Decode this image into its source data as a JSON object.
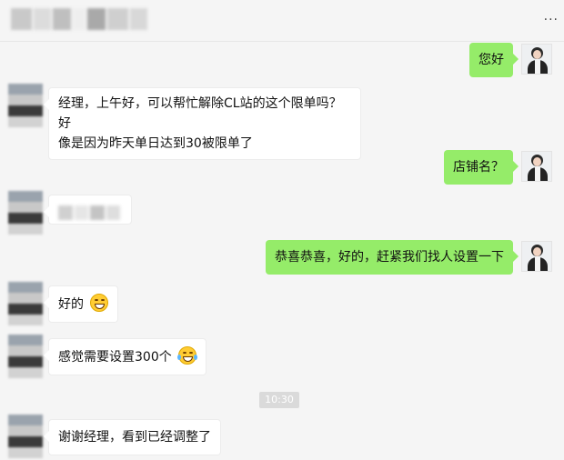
{
  "header": {
    "more_label": "···"
  },
  "messages": [
    {
      "from": "me",
      "text": "您好"
    },
    {
      "from": "other",
      "line1": "经理，上午好，可以帮忙解除CL站的这个限单吗？好",
      "line2": "像是因为昨天单日达到30被限单了"
    },
    {
      "from": "me",
      "text": "店铺名？"
    },
    {
      "from": "other",
      "blurred": true
    },
    {
      "from": "me",
      "text": "恭喜恭喜，好的，赶紧我们找人设置一下"
    },
    {
      "from": "other",
      "text": "好的",
      "emoji": "grin-emoji"
    },
    {
      "from": "other",
      "text": "感觉需要设置300个",
      "emoji": "tears-of-joy-emoji"
    },
    {
      "from": "other",
      "text": "谢谢经理，看到已经调整了"
    }
  ],
  "timestamp": "10:30",
  "colors": {
    "sent_bubble": "#95ec69",
    "received_bubble": "#ffffff",
    "background": "#f5f5f5"
  }
}
